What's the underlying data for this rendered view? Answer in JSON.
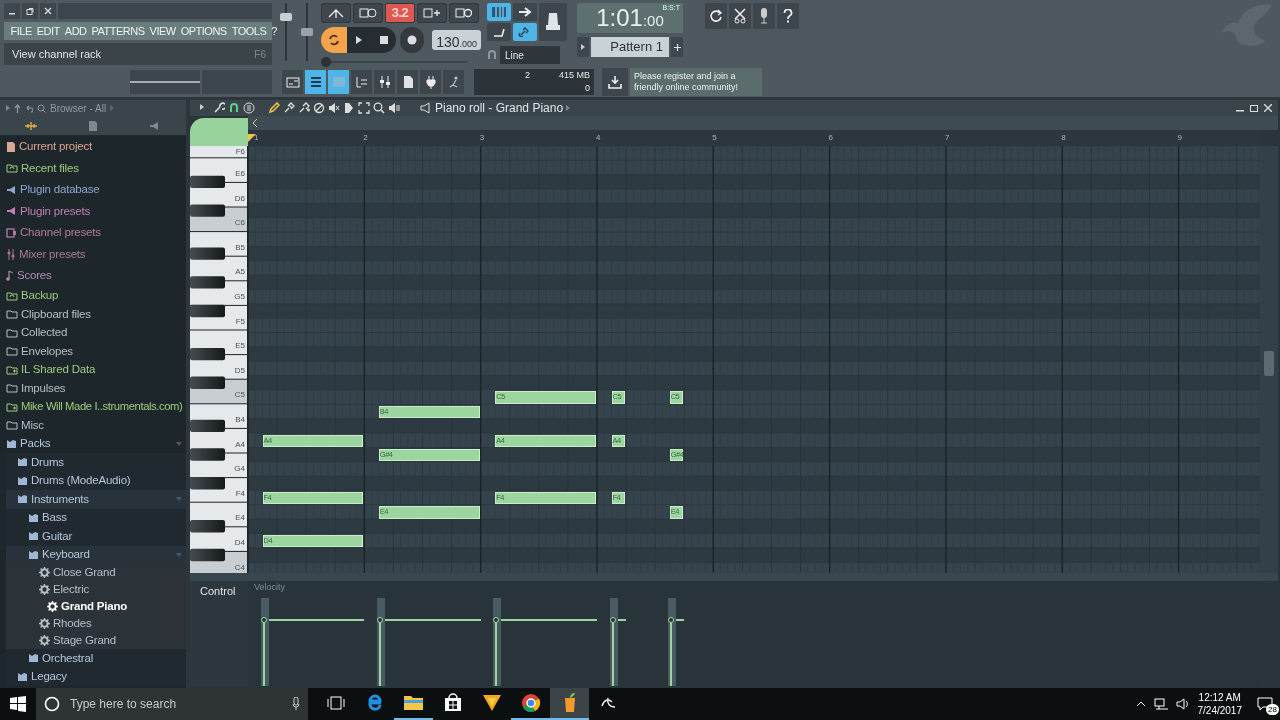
{
  "menu": [
    "FILE",
    "EDIT",
    "ADD",
    "PATTERNS",
    "VIEW",
    "OPTIONS",
    "TOOLS",
    "?"
  ],
  "hint": {
    "text": "View channel rack",
    "shortcut": "F6"
  },
  "master_volume": {
    "level": 0.8
  },
  "master_pitch": {
    "level": 0.5
  },
  "transport": {
    "countdown": "3.2",
    "loop_record_on": true,
    "tempo": {
      "main": "130",
      "fraction": ".000"
    },
    "song_position": {
      "level": 0
    }
  },
  "snap": {
    "label": "Line"
  },
  "time": {
    "main": "1:01",
    "fraction": ":00",
    "unit": "B:S:T"
  },
  "pattern": {
    "label": "Pattern 1"
  },
  "view_buttons": [
    {
      "selected": false
    },
    {
      "selected": true
    },
    {
      "selected": true
    },
    {
      "selected": false
    },
    {
      "selected": false
    },
    {
      "selected": false
    },
    {
      "selected": false
    },
    {
      "selected": false
    }
  ],
  "monitor": {
    "polyphony": "2",
    "memory": "415 MB",
    "cpu": "0"
  },
  "news": {
    "text": "Please register and join a friendly online community!"
  },
  "browser": {
    "title": "Browser - All",
    "items": [
      {
        "label": "Current project",
        "kind": "project",
        "color": "#d9a691"
      },
      {
        "label": "Recent files",
        "kind": "recent",
        "color": "#9ccc7c"
      },
      {
        "label": "Plugin database",
        "kind": "plugin",
        "color": "#8fa6cc"
      },
      {
        "label": "Plugin presets",
        "kind": "plugin",
        "color": "#c37fb5"
      },
      {
        "label": "Channel presets",
        "kind": "channel",
        "color": "#b27a9e"
      },
      {
        "label": "Mixer presets",
        "kind": "mixer",
        "color": "#a77a98"
      },
      {
        "label": "Scores",
        "kind": "score",
        "color": "#b08fb0"
      },
      {
        "label": "Backup",
        "kind": "recent",
        "color": "#9ccc7c"
      },
      {
        "label": "Clipboard files",
        "kind": "folder",
        "color": "#b4bfc8"
      },
      {
        "label": "Collected",
        "kind": "folder",
        "color": "#b4bfc8"
      },
      {
        "label": "Envelopes",
        "kind": "folder",
        "color": "#b4bfc8"
      },
      {
        "label": "IL Shared Data",
        "kind": "linked",
        "color": "#9ccc7c"
      },
      {
        "label": "Impulses",
        "kind": "folder",
        "color": "#b4bfc8"
      },
      {
        "label": "Mike Will Made I..strumentals.com)",
        "kind": "linked",
        "color": "#9ccc7c"
      },
      {
        "label": "Misc",
        "kind": "folder",
        "color": "#b4bfc8"
      },
      {
        "label": "Packs",
        "kind": "pack",
        "color": "#b4c6dc",
        "expanded": true,
        "children": [
          {
            "label": "Drums",
            "kind": "pack",
            "color": "#b4c6dc",
            "expanded": false
          },
          {
            "label": "Drums (ModeAudio)",
            "kind": "pack",
            "color": "#b4c6dc",
            "expanded": false
          },
          {
            "label": "Instruments",
            "kind": "pack",
            "color": "#b4c6dc",
            "expanded": true,
            "children": [
              {
                "label": "Bass",
                "kind": "pack",
                "color": "#b4c6dc",
                "expanded": false
              },
              {
                "label": "Guitar",
                "kind": "pack",
                "color": "#b4c6dc",
                "expanded": false
              },
              {
                "label": "Keyboard",
                "kind": "pack",
                "color": "#b4c6dc",
                "expanded": true,
                "children": [
                  {
                    "label": "Close Grand",
                    "kind": "preset",
                    "color": "#b4bfc8",
                    "selected": false
                  },
                  {
                    "label": "Electric",
                    "kind": "preset",
                    "color": "#b4bfc8",
                    "selected": false
                  },
                  {
                    "label": "Grand Piano",
                    "kind": "preset",
                    "color": "#ffffff",
                    "selected": true
                  },
                  {
                    "label": "Rhodes",
                    "kind": "preset",
                    "color": "#b4bfc8",
                    "selected": false
                  },
                  {
                    "label": "Stage Grand",
                    "kind": "preset",
                    "color": "#b4bfc8",
                    "selected": false
                  }
                ]
              },
              {
                "label": "Orchestral",
                "kind": "pack",
                "color": "#b4c6dc",
                "expanded": false
              }
            ]
          },
          {
            "label": "Legacy",
            "kind": "pack",
            "color": "#b4c6dc",
            "expanded": false
          }
        ]
      }
    ]
  },
  "piano_roll": {
    "title": "Piano roll - Grand Piano",
    "bars": [
      "1",
      "2",
      "3",
      "4",
      "5",
      "6",
      "7",
      "8",
      "9"
    ],
    "keys": [
      "F6",
      "E6",
      "D6",
      "C6",
      "B5",
      "A5",
      "G5",
      "F5",
      "E5",
      "D5",
      "C5",
      "B4",
      "A4",
      "G4",
      "F4",
      "E4",
      "D4",
      "C4"
    ],
    "notes": [
      {
        "label": "A4",
        "level": 0.78
      },
      {
        "label": "F4",
        "level": 0.78
      },
      {
        "label": "D4",
        "level": 0.78
      },
      {
        "label": "B4",
        "level": 0.78
      },
      {
        "label": "G#4",
        "level": 0.78
      },
      {
        "label": "E4",
        "level": 0.78
      },
      {
        "label": "C5",
        "level": 0.78
      },
      {
        "label": "A4",
        "level": 0.78
      },
      {
        "label": "F4",
        "level": 0.78
      },
      {
        "label": "C5",
        "level": 0.78
      },
      {
        "label": "A4",
        "level": 0.78
      },
      {
        "label": "F4",
        "level": 0.78
      },
      {
        "label": "C5",
        "level": 0.78
      },
      {
        "label": "G#4",
        "level": 0.78
      },
      {
        "label": "E4",
        "level": 0.78
      }
    ],
    "control": {
      "label": "Control",
      "parameter": "Velocity"
    }
  },
  "taskbar": {
    "search_placeholder": "Type here to search",
    "time": "12:12 AM",
    "date": "7/24/2017",
    "notifications": "28",
    "apps": [
      {
        "kind": "browser",
        "running": false,
        "selected": false
      },
      {
        "kind": "folder",
        "running": true,
        "selected": false
      },
      {
        "kind": "store",
        "running": false,
        "selected": false
      },
      {
        "kind": "cone",
        "running": false,
        "selected": false
      },
      {
        "kind": "chrome",
        "running": true,
        "selected": false
      },
      {
        "kind": "fruit",
        "running": true,
        "selected": true
      },
      {
        "kind": "swirl",
        "running": false,
        "selected": false
      }
    ]
  }
}
